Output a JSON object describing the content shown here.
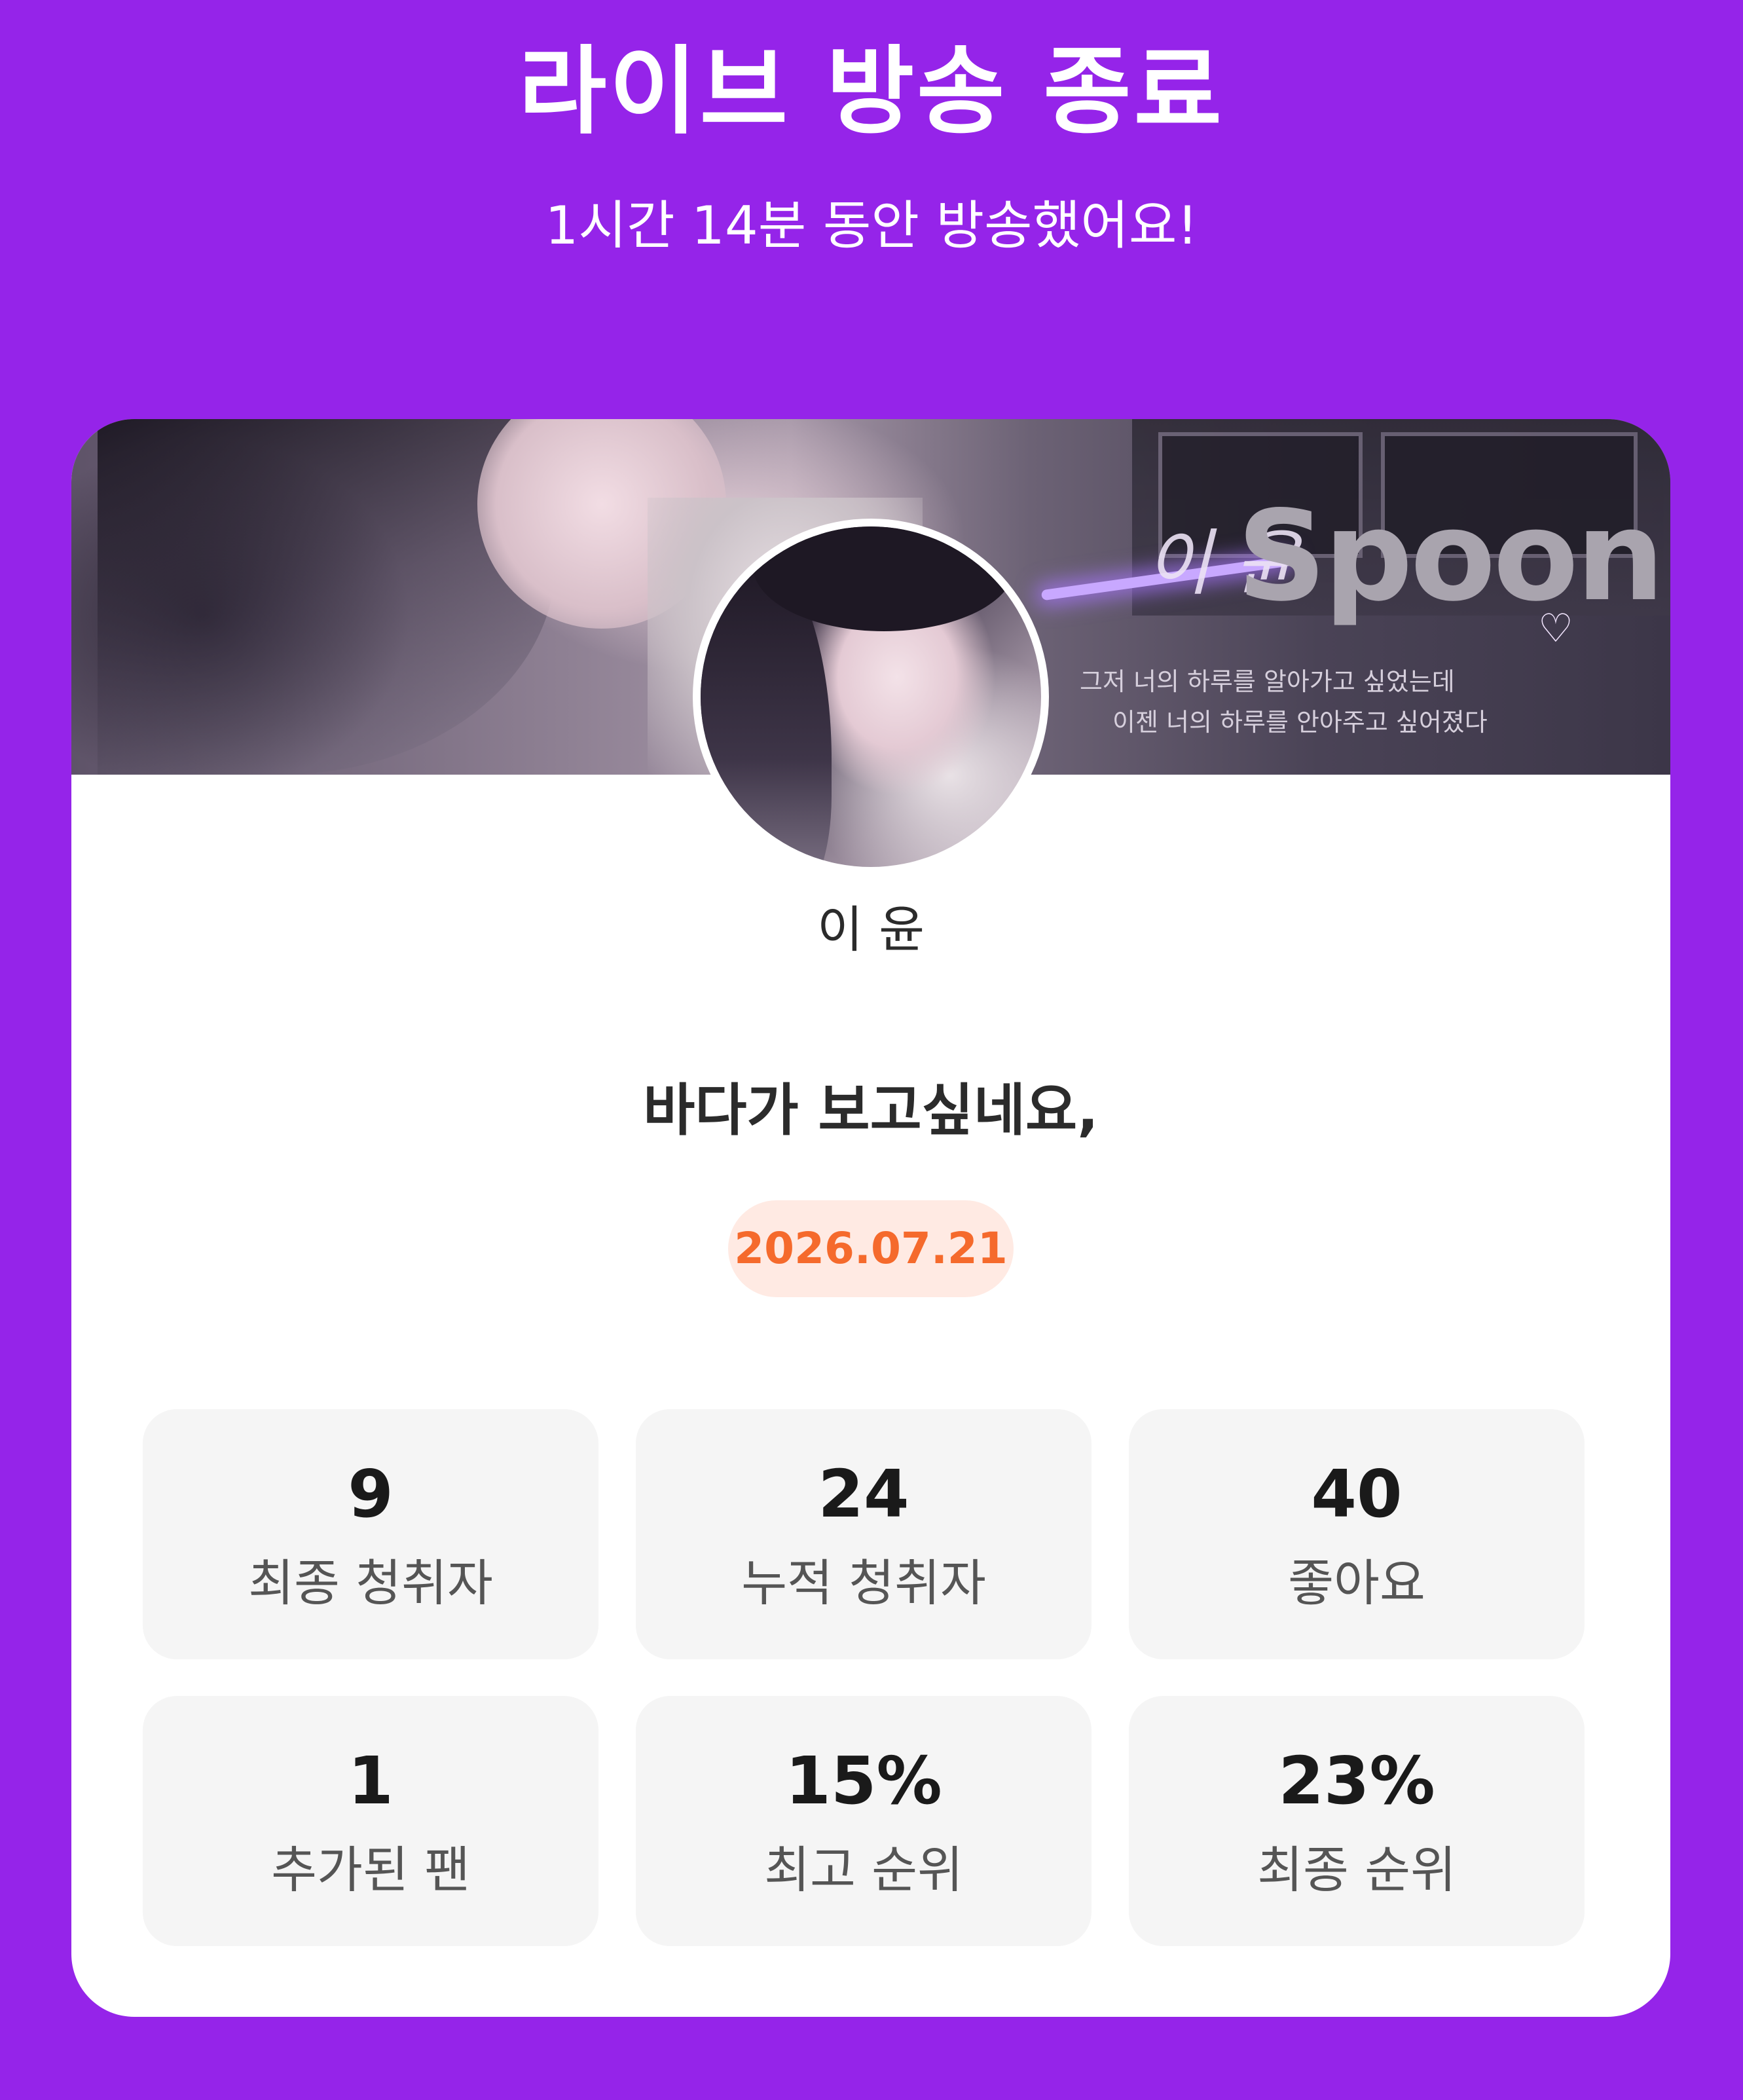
{
  "header": {
    "title": "라이브 방송 종료",
    "subtitle": "1시간 14분 동안 방송했어요!"
  },
  "banner": {
    "logo_text": "Spoon",
    "script_text": "이 윤",
    "quote_lines": [
      "그저 너의 하루를 알아가고 싶었는데",
      "이젠 너의 하루를 안아주고 싶어졌다"
    ]
  },
  "profile": {
    "name": "이 윤"
  },
  "broadcast": {
    "title": "바다가 보고싶네요,",
    "date": "2026.07.21"
  },
  "stats": [
    {
      "value": "9",
      "label": "최종 청취자"
    },
    {
      "value": "24",
      "label": "누적 청취자"
    },
    {
      "value": "40",
      "label": "좋아요"
    },
    {
      "value": "1",
      "label": "추가된 팬"
    },
    {
      "value": "15%",
      "label": "최고 순위"
    },
    {
      "value": "23%",
      "label": "최종 순위"
    }
  ],
  "colors": {
    "background": "#9524E9",
    "date_text": "#F56A2C",
    "date_badge_bg": "#FFEAE3",
    "tile_bg": "#F5F5F5"
  },
  "icons": {
    "heart": "heart-icon"
  }
}
